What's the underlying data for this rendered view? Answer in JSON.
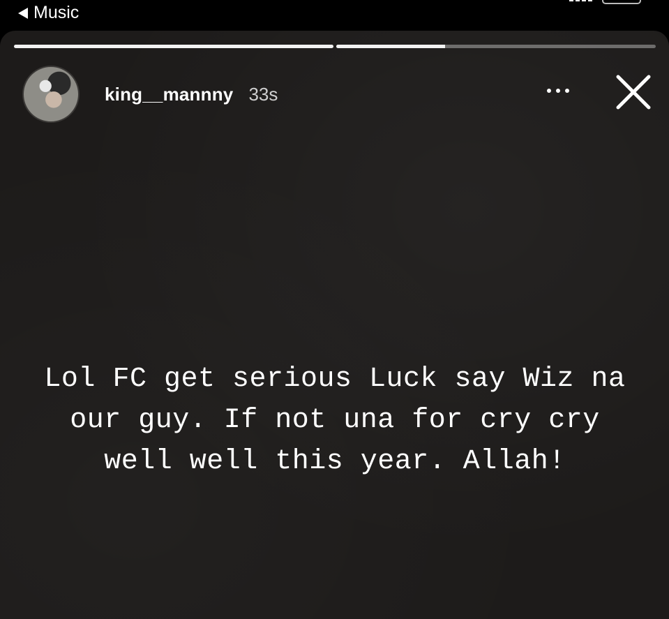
{
  "status_bar": {
    "back_app_label": "Music"
  },
  "story": {
    "progress_segments": [
      {
        "fill_fraction": 1.0
      },
      {
        "fill_fraction": 0.34
      }
    ],
    "username": "king__mannny",
    "timestamp": "33s",
    "text": "Lol FC get serious Luck say Wiz na our guy. If not una for cry cry well well this year. Allah!",
    "icons": {
      "more": "more-horizontal-icon",
      "close": "close-icon",
      "back": "back-triangle-icon"
    },
    "colors": {
      "background": "#1d1b1a",
      "text": "#ffffff",
      "timestamp": "#cfcfcf"
    }
  }
}
